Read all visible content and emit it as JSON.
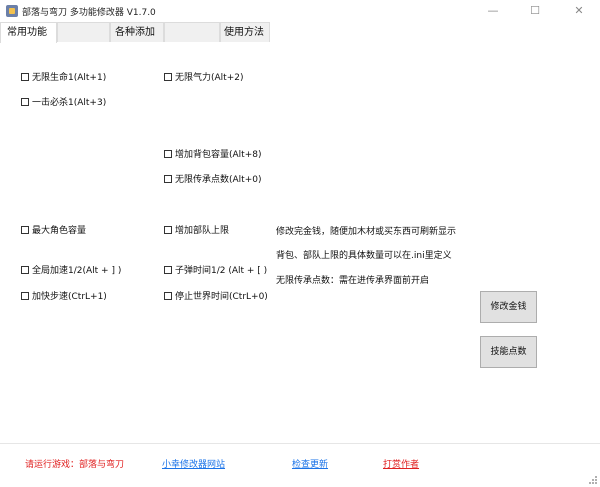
{
  "window": {
    "title": "部落与弯刀 多功能修改器  V1.7.0",
    "minimize_glyph": "—",
    "maximize_glyph": "☐",
    "close_glyph": "✕"
  },
  "tabs": [
    {
      "label": "常用功能",
      "active": true
    },
    {
      "label": ""
    },
    {
      "label": "各种添加"
    },
    {
      "label": ""
    },
    {
      "label": "使用方法"
    }
  ],
  "options": {
    "infinite_health": "无限生命1(Alt+1)",
    "infinite_stamina": "无限气力(Alt+2)",
    "one_hit_kill": "一击必杀1(Alt+3)",
    "bag_capacity": "增加背包容量(Alt+8)",
    "infinite_inherit": "无限传承点数(Alt+0)",
    "max_roles": "最大角色容量",
    "team_limit": "增加部队上限",
    "global_speed": "全局加速1/2(Alt + ] )",
    "bullet_time": "子弹时间1/2 (Alt + [ )",
    "walk_speed": "加快步速(CtrL+1)",
    "stop_time": "停止世界时间(CtrL+0)"
  },
  "info": {
    "line1": "修改完金钱，随便加木材或买东西可刷新显示",
    "line2": "背包、部队上限的具体数量可以在.ini里定义",
    "line3": "无限传承点数：需在进传承界面前开启"
  },
  "buttons": {
    "edit_money": "修改金钱",
    "skill_points": "技能点数"
  },
  "footer": {
    "status": "请运行游戏：部落与弯刀",
    "site": "小幸修改器网站",
    "update": "检查更新",
    "reward": "打赏作者"
  }
}
